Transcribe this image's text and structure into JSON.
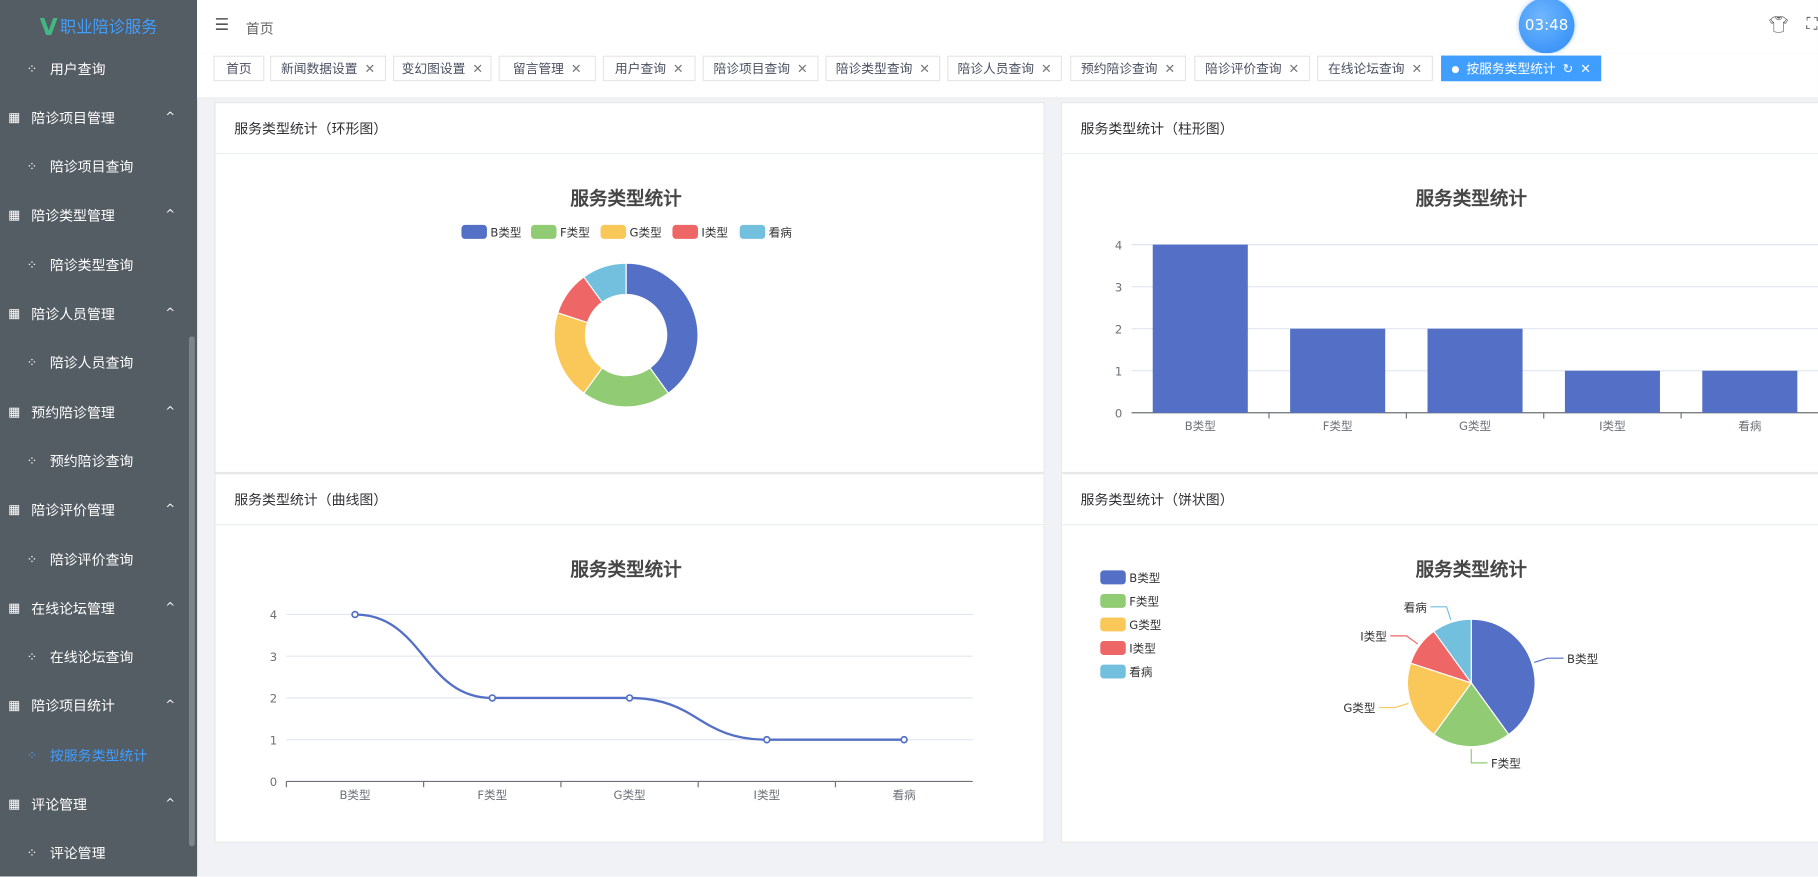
{
  "app": {
    "title": "职业陪诊服务",
    "logo_letter": "V"
  },
  "sidebar": {
    "items": [
      {
        "type": "sub",
        "label": "用户查询"
      },
      {
        "type": "group",
        "label": "陪诊项目管理"
      },
      {
        "type": "sub",
        "label": "陪诊项目查询"
      },
      {
        "type": "group",
        "label": "陪诊类型管理"
      },
      {
        "type": "sub",
        "label": "陪诊类型查询"
      },
      {
        "type": "group",
        "label": "陪诊人员管理"
      },
      {
        "type": "sub",
        "label": "陪诊人员查询"
      },
      {
        "type": "group",
        "label": "预约陪诊管理"
      },
      {
        "type": "sub",
        "label": "预约陪诊查询"
      },
      {
        "type": "group",
        "label": "陪诊评价管理"
      },
      {
        "type": "sub",
        "label": "陪诊评价查询"
      },
      {
        "type": "group",
        "label": "在线论坛管理"
      },
      {
        "type": "sub",
        "label": "在线论坛查询"
      },
      {
        "type": "group",
        "label": "陪诊项目统计"
      },
      {
        "type": "sub",
        "label": "按服务类型统计",
        "active": true
      },
      {
        "type": "group",
        "label": "评论管理"
      },
      {
        "type": "sub",
        "label": "评论管理"
      }
    ]
  },
  "header": {
    "breadcrumb": "首页",
    "timer": "03:48"
  },
  "tabs": [
    {
      "label": "首页",
      "closable": false
    },
    {
      "label": "新闻数据设置",
      "closable": true
    },
    {
      "label": "变幻图设置",
      "closable": true
    },
    {
      "label": "留言管理",
      "closable": true
    },
    {
      "label": "用户查询",
      "closable": true
    },
    {
      "label": "陪诊项目查询",
      "closable": true
    },
    {
      "label": "陪诊类型查询",
      "closable": true
    },
    {
      "label": "陪诊人员查询",
      "closable": true
    },
    {
      "label": "预约陪诊查询",
      "closable": true
    },
    {
      "label": "陪诊评价查询",
      "closable": true
    },
    {
      "label": "在线论坛查询",
      "closable": true
    },
    {
      "label": "按服务类型统计",
      "closable": true,
      "active": true
    }
  ],
  "colors": [
    "#5470c6",
    "#91cc75",
    "#fac858",
    "#ee6666",
    "#73c0de"
  ],
  "cards": {
    "donut": "服务类型统计（环形图）",
    "bar": "服务类型统计（柱形图）",
    "line": "服务类型统计（曲线图）",
    "pie": "服务类型统计（饼状图）"
  },
  "chart_data": [
    {
      "type": "pie",
      "variant": "donut",
      "title": "服务类型统计",
      "categories": [
        "B类型",
        "F类型",
        "G类型",
        "I类型",
        "看病"
      ],
      "values": [
        4,
        2,
        2,
        1,
        1
      ],
      "legend": "top"
    },
    {
      "type": "bar",
      "title": "服务类型统计",
      "categories": [
        "B类型",
        "F类型",
        "G类型",
        "I类型",
        "看病"
      ],
      "values": [
        4,
        2,
        2,
        1,
        1
      ],
      "ylim": [
        0,
        4
      ],
      "yticks": [
        "0",
        "1",
        "2",
        "3",
        "4"
      ]
    },
    {
      "type": "line",
      "smooth": true,
      "title": "服务类型统计",
      "categories": [
        "B类型",
        "F类型",
        "G类型",
        "I类型",
        "看病"
      ],
      "values": [
        4,
        2,
        2,
        1,
        1
      ],
      "ylim": [
        0,
        4
      ],
      "yticks": [
        "0",
        "1",
        "2",
        "3",
        "4"
      ]
    },
    {
      "type": "pie",
      "title": "服务类型统计",
      "categories": [
        "B类型",
        "F类型",
        "G类型",
        "I类型",
        "看病"
      ],
      "values": [
        4,
        2,
        2,
        1,
        1
      ],
      "legend": "left"
    }
  ]
}
